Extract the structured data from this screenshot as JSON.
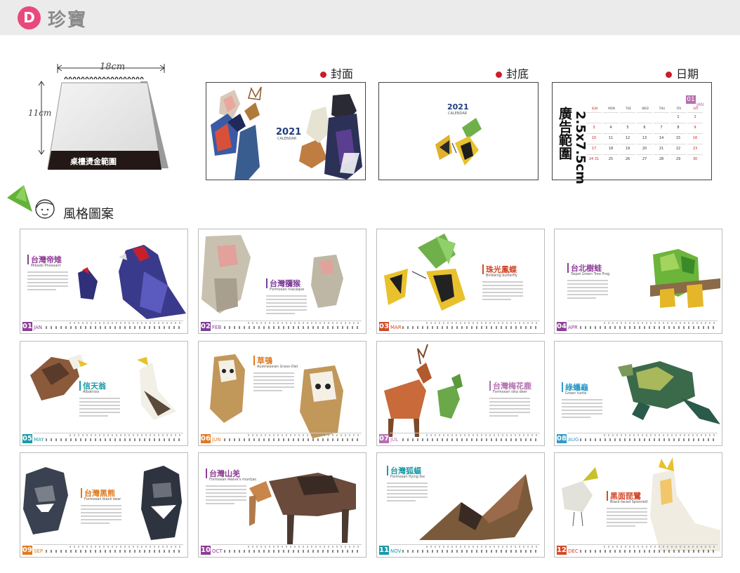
{
  "header": {
    "badge": "D",
    "title": "珍寶"
  },
  "mockup": {
    "width_label": "18cm",
    "height_label": "11cm",
    "band_label": "桌檯燙金範圍"
  },
  "panels": {
    "cover": {
      "label": "封面",
      "year": "2021",
      "sub": "CALENDAR"
    },
    "back": {
      "label": "封底",
      "year": "2021",
      "sub": "CALENDAR"
    },
    "date": {
      "label": "日期",
      "ad_lines": [
        "2.5x7.5cm",
        "廣告範圍"
      ],
      "month_num": "01",
      "month_abbr": "JAN",
      "weekdays": [
        "SUN",
        "MON",
        "TUE",
        "WED",
        "THU",
        "FRI",
        "SAT"
      ],
      "rows": [
        [
          "",
          "",
          "",
          "",
          "",
          "1",
          "2"
        ],
        [
          "3",
          "4",
          "5",
          "6",
          "7",
          "8",
          "9"
        ],
        [
          "10",
          "11",
          "12",
          "13",
          "14",
          "15",
          "16"
        ],
        [
          "17",
          "18",
          "19",
          "20",
          "21",
          "22",
          "23"
        ],
        [
          "24 31",
          "25",
          "26",
          "27",
          "28",
          "29",
          "30"
        ]
      ]
    }
  },
  "section": {
    "title": "風格圖案"
  },
  "colors": {
    "accent_red": "#cc1d2a",
    "badge": "#e9487c",
    "topbar": "#ebebeb"
  },
  "months": [
    {
      "num": "01",
      "abbr": "JAN",
      "cn": "台灣帝雉",
      "en": "Mikado Pheasant",
      "color": "#8e3d97",
      "art": "bird"
    },
    {
      "num": "02",
      "abbr": "FEB",
      "cn": "台灣獼猴",
      "en": "Formosan macaque",
      "color": "#7d3c98",
      "art": "monkey"
    },
    {
      "num": "03",
      "abbr": "MAR",
      "cn": "珠光鳳蝶",
      "en": "Birdwing butterfly",
      "color": "#d24a2b",
      "art": "butterfly"
    },
    {
      "num": "04",
      "abbr": "APR",
      "cn": "台北樹蛙",
      "en": "Taipei Green Tree Frog",
      "color": "#8e3d97",
      "art": "frog"
    },
    {
      "num": "05",
      "abbr": "MAY",
      "cn": "信天翁",
      "en": "Albatross",
      "color": "#1a9aa8",
      "art": "albatross"
    },
    {
      "num": "06",
      "abbr": "JUN",
      "cn": "草鴞",
      "en": "Australasian Grass-Owl",
      "color": "#e07a1f",
      "art": "owl"
    },
    {
      "num": "07",
      "abbr": "JUL",
      "cn": "台灣梅花鹿",
      "en": "Formosan sika deer",
      "color": "#b46fb0",
      "art": "deer"
    },
    {
      "num": "08",
      "abbr": "AUG",
      "cn": "綠蠵龜",
      "en": "Green turtle",
      "color": "#2f9bc9",
      "art": "turtle"
    },
    {
      "num": "09",
      "abbr": "SEP",
      "cn": "台灣黑熊",
      "en": "Formosan black bear",
      "color": "#e07a1f",
      "art": "bear"
    },
    {
      "num": "10",
      "abbr": "OCT",
      "cn": "台灣山羌",
      "en": "Formosan Reeve's muntjac",
      "color": "#8e3d97",
      "art": "muntjac"
    },
    {
      "num": "11",
      "abbr": "NOV",
      "cn": "台灣狐蝠",
      "en": "Formosan flying fox",
      "color": "#1a9aa8",
      "art": "bat"
    },
    {
      "num": "12",
      "abbr": "DEC",
      "cn": "黑面琵鷺",
      "en": "Black-faced Spoonbill",
      "color": "#d24a2b",
      "art": "spoonbill"
    }
  ]
}
